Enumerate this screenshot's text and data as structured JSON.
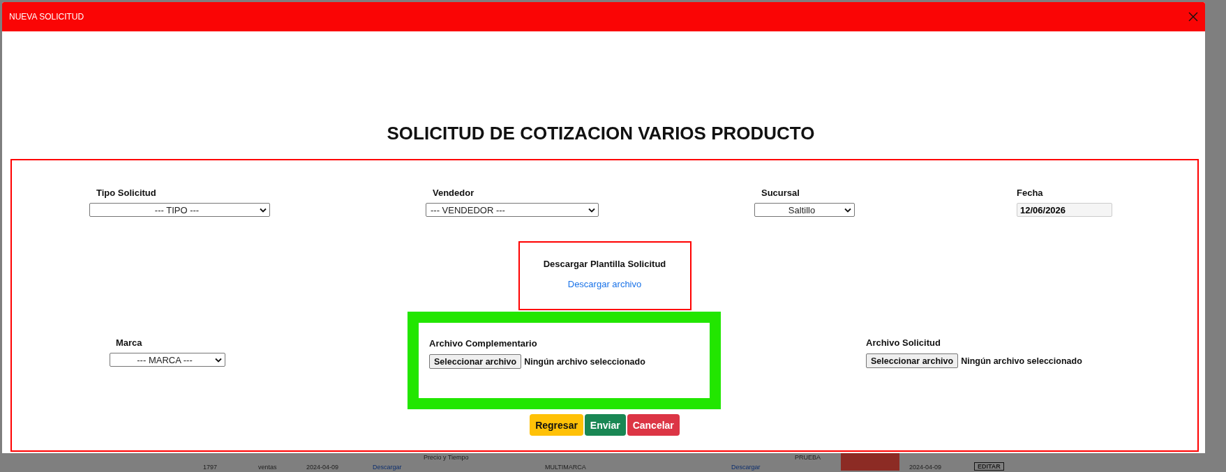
{
  "modal": {
    "title": "NUEVA SOLICITUD"
  },
  "heading": "SOLICITUD DE COTIZACION VARIOS PRODUCTO",
  "fields": [
    {
      "kind": "select",
      "label": "Tipo Solicitud",
      "value": "--- TIPO ---"
    },
    {
      "kind": "select",
      "label": "Vendedor",
      "value": "--- VENDEDOR ---"
    },
    {
      "kind": "select",
      "label": "Sucursal",
      "value": "Saltillo"
    },
    {
      "kind": "date",
      "label": "Fecha",
      "value": "12/06/2026"
    }
  ],
  "template": {
    "title": "Descargar Plantilla Solicitud",
    "link": "Descargar archivo"
  },
  "marca": {
    "label": "Marca",
    "value": "--- MARCA ---"
  },
  "attachments": [
    {
      "label": "Archivo Complementario",
      "button": "Seleccionar archivo",
      "status": "Ningún archivo seleccionado",
      "highlighted": true
    },
    {
      "label": "Archivo Solicitud",
      "button": "Seleccionar archivo",
      "status": "Ningún archivo seleccionado",
      "highlighted": false
    }
  ],
  "buttons": [
    {
      "label": "Regresar",
      "kind": "back"
    },
    {
      "label": "Enviar",
      "kind": "submit"
    },
    {
      "label": "Cancelar",
      "kind": "cancel"
    }
  ],
  "background_row": [
    {
      "kind": "text",
      "text": "1797"
    },
    {
      "kind": "text",
      "text": "ventas"
    },
    {
      "kind": "text",
      "text": "2024-04-09"
    },
    {
      "kind": "link",
      "text": "Descargar"
    },
    {
      "kind": "text",
      "text": "Precio y Tiempo"
    },
    {
      "kind": "text",
      "text": "MULTIMARCA"
    },
    {
      "kind": "link",
      "text": "Descargar"
    },
    {
      "kind": "text",
      "text": "PRUEBA"
    },
    {
      "kind": "status"
    },
    {
      "kind": "text",
      "text": "2024-04-09"
    },
    {
      "kind": "button",
      "text": "EDITAR"
    }
  ]
}
